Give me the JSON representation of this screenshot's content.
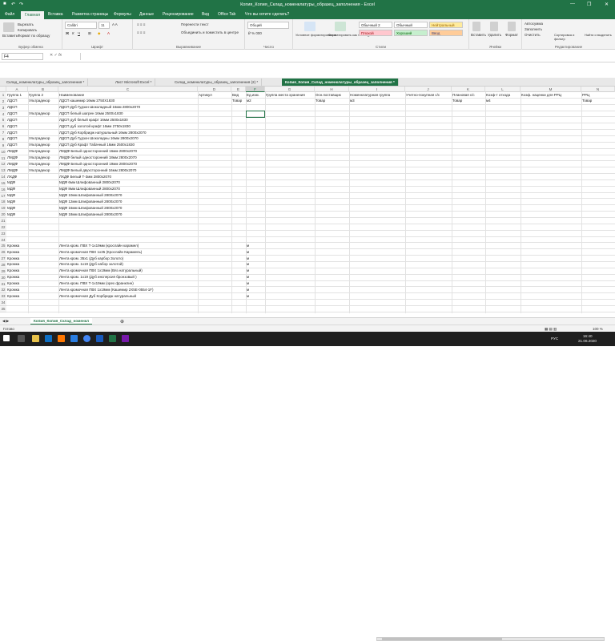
{
  "window": {
    "title": "Копия_Копия_Склад_номенклатуры_образец_заполнения - Excel"
  },
  "ribbon_tabs": [
    "Файл",
    "Главная",
    "Вставка",
    "Разметка страницы",
    "Формулы",
    "Данные",
    "Рецензирование",
    "Вид",
    "Office Tab",
    "Что вы хотите сделать?"
  ],
  "ribbon": {
    "cut": "Вырезать",
    "copy": "Копировать",
    "format_painter": "Формат по образцу",
    "paste": "Вставить",
    "font": "Calibri",
    "size": "11",
    "wrap": "Перенести текст",
    "merge": "Объединить и поместить в центре",
    "numformat": "Общий",
    "cond_format": "Условное форматирование",
    "format_table": "Форматировать как таблицу",
    "styles": {
      "normal2": "Обычный 2",
      "normal": "Обычный",
      "neutral": "Нейтральный",
      "bad": "Плохой",
      "good": "Хороший",
      "input": "Ввод"
    },
    "insert": "Вставить",
    "delete": "Удалить",
    "format": "Формат",
    "autosum": "Автосумма",
    "fill": "Заполнить",
    "clear": "Очистить",
    "sort": "Сортировка и фильтр",
    "find": "Найти и выделить",
    "groups": [
      "Буфер обмена",
      "Шрифт",
      "Выравнивание",
      "Число",
      "Стили",
      "Ячейки",
      "Редактирование"
    ]
  },
  "formula_bar": {
    "name_box": "F4",
    "fx": "fx",
    "value": ""
  },
  "window_tabs": [
    {
      "label": "Склад_номенклатуры_образец_заполнения *",
      "active": false
    },
    {
      "label": "Лист Microsoft Excel *",
      "active": false
    },
    {
      "label": "Склад_номенклатуры_образец_заполнения (2) *",
      "active": false
    },
    {
      "label": "Копия_Копия_Склад_номенклатуры_образец_заполнения *",
      "active": true
    }
  ],
  "columns": [
    "A",
    "B",
    "C",
    "D",
    "E",
    "F",
    "G",
    "H",
    "I",
    "J",
    "K",
    "L",
    "M",
    "N"
  ],
  "selected_column": "F",
  "rows": [
    [
      "Группа 1",
      "Группа 2",
      "Наименование",
      "Артикул",
      "Вид",
      "Ед.изм.",
      "Группа места хранения",
      "Осн.поставщик",
      "Номенклатурная группа",
      "Учетно-покупная с/с",
      "Плановая с/с",
      "Коэф-т отхода",
      "Коэф. наценки для РРЦ",
      "РРЦ"
    ],
    [
      "ЛДСП",
      "Ультрадекор",
      "ЛДСП кашемир 16мм 2750Х1830",
      "",
      "Товар",
      "м2",
      "",
      "Товар",
      "м3",
      "",
      "Товар",
      "м4",
      "",
      "Товар"
    ],
    [
      "ЛДСП",
      "",
      "ЛДСП Дуб Гудзон Шоколадный 16мм 2800х2070",
      "",
      "",
      "",
      "",
      "",
      "",
      "",
      "",
      "",
      "",
      ""
    ],
    [
      "ЛДСП",
      "Ультрадекор",
      "ЛДСП белый шагрен 16мм 2500х1830",
      "",
      "",
      "",
      "",
      "",
      "",
      "",
      "",
      "",
      "",
      ""
    ],
    [
      "ЛДСП",
      "",
      "ЛДСП дуб белый крафт 16мм 2500х1830",
      "",
      "",
      "",
      "",
      "",
      "",
      "",
      "",
      "",
      "",
      ""
    ],
    [
      "ЛДСП",
      "",
      "ЛДСП дуб золотой крафт 16мм 2750х1830",
      "",
      "",
      "",
      "",
      "",
      "",
      "",
      "",
      "",
      "",
      ""
    ],
    [
      "ЛДСП",
      "",
      "ЛДСП Дуб Корбридж натуральный 16мм 2800х2070",
      "",
      "",
      "",
      "",
      "",
      "",
      "",
      "",
      "",
      "",
      ""
    ],
    [
      "ЛДСП",
      "Ультрадекор",
      "ЛДСП Дуб Гудзон Шоколадны 16мм 2800х2070",
      "",
      "",
      "",
      "",
      "",
      "",
      "",
      "",
      "",
      "",
      ""
    ],
    [
      "ЛДСП",
      "Ультрадекор",
      "ЛДСП Дуб Крафт Табачный 16мм 2500х1830",
      "",
      "",
      "",
      "",
      "",
      "",
      "",
      "",
      "",
      "",
      ""
    ],
    [
      "ЛМДФ",
      "Ультрадекор",
      "ЛМДФ Белый односторонний 16мм 2800х2070",
      "",
      "",
      "",
      "",
      "",
      "",
      "",
      "",
      "",
      "",
      ""
    ],
    [
      "ЛМДФ",
      "Ультрадекор",
      "ЛМДФ белый односторонний 18мм 2800х2070",
      "",
      "",
      "",
      "",
      "",
      "",
      "",
      "",
      "",
      "",
      ""
    ],
    [
      "ЛМДФ",
      "Ультрадекор",
      "ЛМДФ Белый односторонний 19мм 2800х2070",
      "",
      "",
      "",
      "",
      "",
      "",
      "",
      "",
      "",
      "",
      ""
    ],
    [
      "ЛМДФ",
      "Ультрадекор",
      "ЛМДФ Белый двухсторонний 16мм 2800х2070",
      "",
      "",
      "",
      "",
      "",
      "",
      "",
      "",
      "",
      "",
      ""
    ],
    [
      "ЛХДФ",
      "",
      "ЛХДФ Белый Т-3мм 2800х2070",
      "",
      "",
      "",
      "",
      "",
      "",
      "",
      "",
      "",
      "",
      ""
    ],
    [
      "МДФ",
      "",
      "МДФ 6мм Шлифованный 2800х2070",
      "",
      "",
      "",
      "",
      "",
      "",
      "",
      "",
      "",
      "",
      ""
    ],
    [
      "МДФ",
      "",
      "МДФ 8мм Шлифованный 2800х2070",
      "",
      "",
      "",
      "",
      "",
      "",
      "",
      "",
      "",
      "",
      ""
    ],
    [
      "МДФ",
      "",
      "МДФ 10мм Шлифованный 2800х2070",
      "",
      "",
      "",
      "",
      "",
      "",
      "",
      "",
      "",
      "",
      ""
    ],
    [
      "МДФ",
      "",
      "МДФ 12мм Шлифованный 2800х2070",
      "",
      "",
      "",
      "",
      "",
      "",
      "",
      "",
      "",
      "",
      ""
    ],
    [
      "МДФ",
      "",
      "МДФ 16мм Шлифованный 2800х2070",
      "",
      "",
      "",
      "",
      "",
      "",
      "",
      "",
      "",
      "",
      ""
    ],
    [
      "МДФ",
      "",
      "МДФ 18мм Шлифованный 2800х2070",
      "",
      "",
      "",
      "",
      "",
      "",
      "",
      "",
      "",
      "",
      ""
    ],
    [
      "",
      "",
      "",
      "",
      "",
      "",
      "",
      "",
      "",
      "",
      "",
      "",
      "",
      ""
    ],
    [
      "",
      "",
      "",
      "",
      "",
      "",
      "",
      "",
      "",
      "",
      "",
      "",
      "",
      ""
    ],
    [
      "",
      "",
      "",
      "",
      "",
      "",
      "",
      "",
      "",
      "",
      "",
      "",
      "",
      ""
    ],
    [
      "",
      "",
      "",
      "",
      "",
      "",
      "",
      "",
      "",
      "",
      "",
      "",
      "",
      ""
    ],
    [
      "Кромка",
      "",
      "Лента кром. ПВХ Т-1х19мм (крослайн карамел)",
      "",
      "",
      "м",
      "",
      "",
      "",
      "",
      "",
      "",
      "",
      ""
    ],
    [
      "Кромка",
      "",
      "Лента кромочная ПВХ 1х35 (Крослайн Карамель)",
      "",
      "",
      "м",
      "",
      "",
      "",
      "",
      "",
      "",
      "",
      ""
    ],
    [
      "Кромка",
      "",
      "Лента кром. 35х1 (Дуб карбор Золото)",
      "",
      "",
      "м",
      "",
      "",
      "",
      "",
      "",
      "",
      "",
      ""
    ],
    [
      "Кромка",
      "",
      "Лента кром. 1х19 (Дуб набор золотой)",
      "",
      "",
      "м",
      "",
      "",
      "",
      "",
      "",
      "",
      "",
      ""
    ],
    [
      "Кромка",
      "",
      "Лента кромочная ПВХ 1х19мм (Вяз натуральный)",
      "",
      "",
      "м",
      "",
      "",
      "",
      "",
      "",
      "",
      "",
      ""
    ],
    [
      "Кромка",
      "",
      "Лента кром. 1х19 (Дуб инсперсия бронзовый )",
      "",
      "",
      "м",
      "",
      "",
      "",
      "",
      "",
      "",
      "",
      ""
    ],
    [
      "Кромка",
      "",
      "Лента кром. ПВХ Т-1х19мм (орех франклин)",
      "",
      "",
      "м",
      "",
      "",
      "",
      "",
      "",
      "",
      "",
      ""
    ],
    [
      "Кромка",
      "",
      "Лента кромочная ПВХ 1х19мм (Кашемир 2Х5Е-0554-1F)",
      "",
      "",
      "м",
      "",
      "",
      "",
      "",
      "",
      "",
      "",
      ""
    ],
    [
      "Кромка",
      "",
      "Лента кромочная Дуб Корбридж натуральный",
      "",
      "",
      "м",
      "",
      "",
      "",
      "",
      "",
      "",
      "",
      ""
    ],
    [
      "",
      "",
      "",
      "",
      "",
      "",
      "",
      "",
      "",
      "",
      "",
      "",
      "",
      ""
    ],
    [
      "",
      "",
      "",
      "",
      "",
      "",
      "",
      "",
      "",
      "",
      "",
      "",
      "",
      ""
    ]
  ],
  "sheet_tab": "Копия_Копия_Склад_номенкл",
  "status": {
    "ready": "Готово",
    "zoom": "100 %"
  },
  "taskbar": {
    "time": "16:40",
    "date": "21.06.2020",
    "lang": "РУС"
  },
  "colors": {
    "excel_green": "#217346",
    "bad_bg": "#ffc7ce",
    "good_bg": "#c6efce",
    "neutral_bg": "#ffeb9c"
  }
}
